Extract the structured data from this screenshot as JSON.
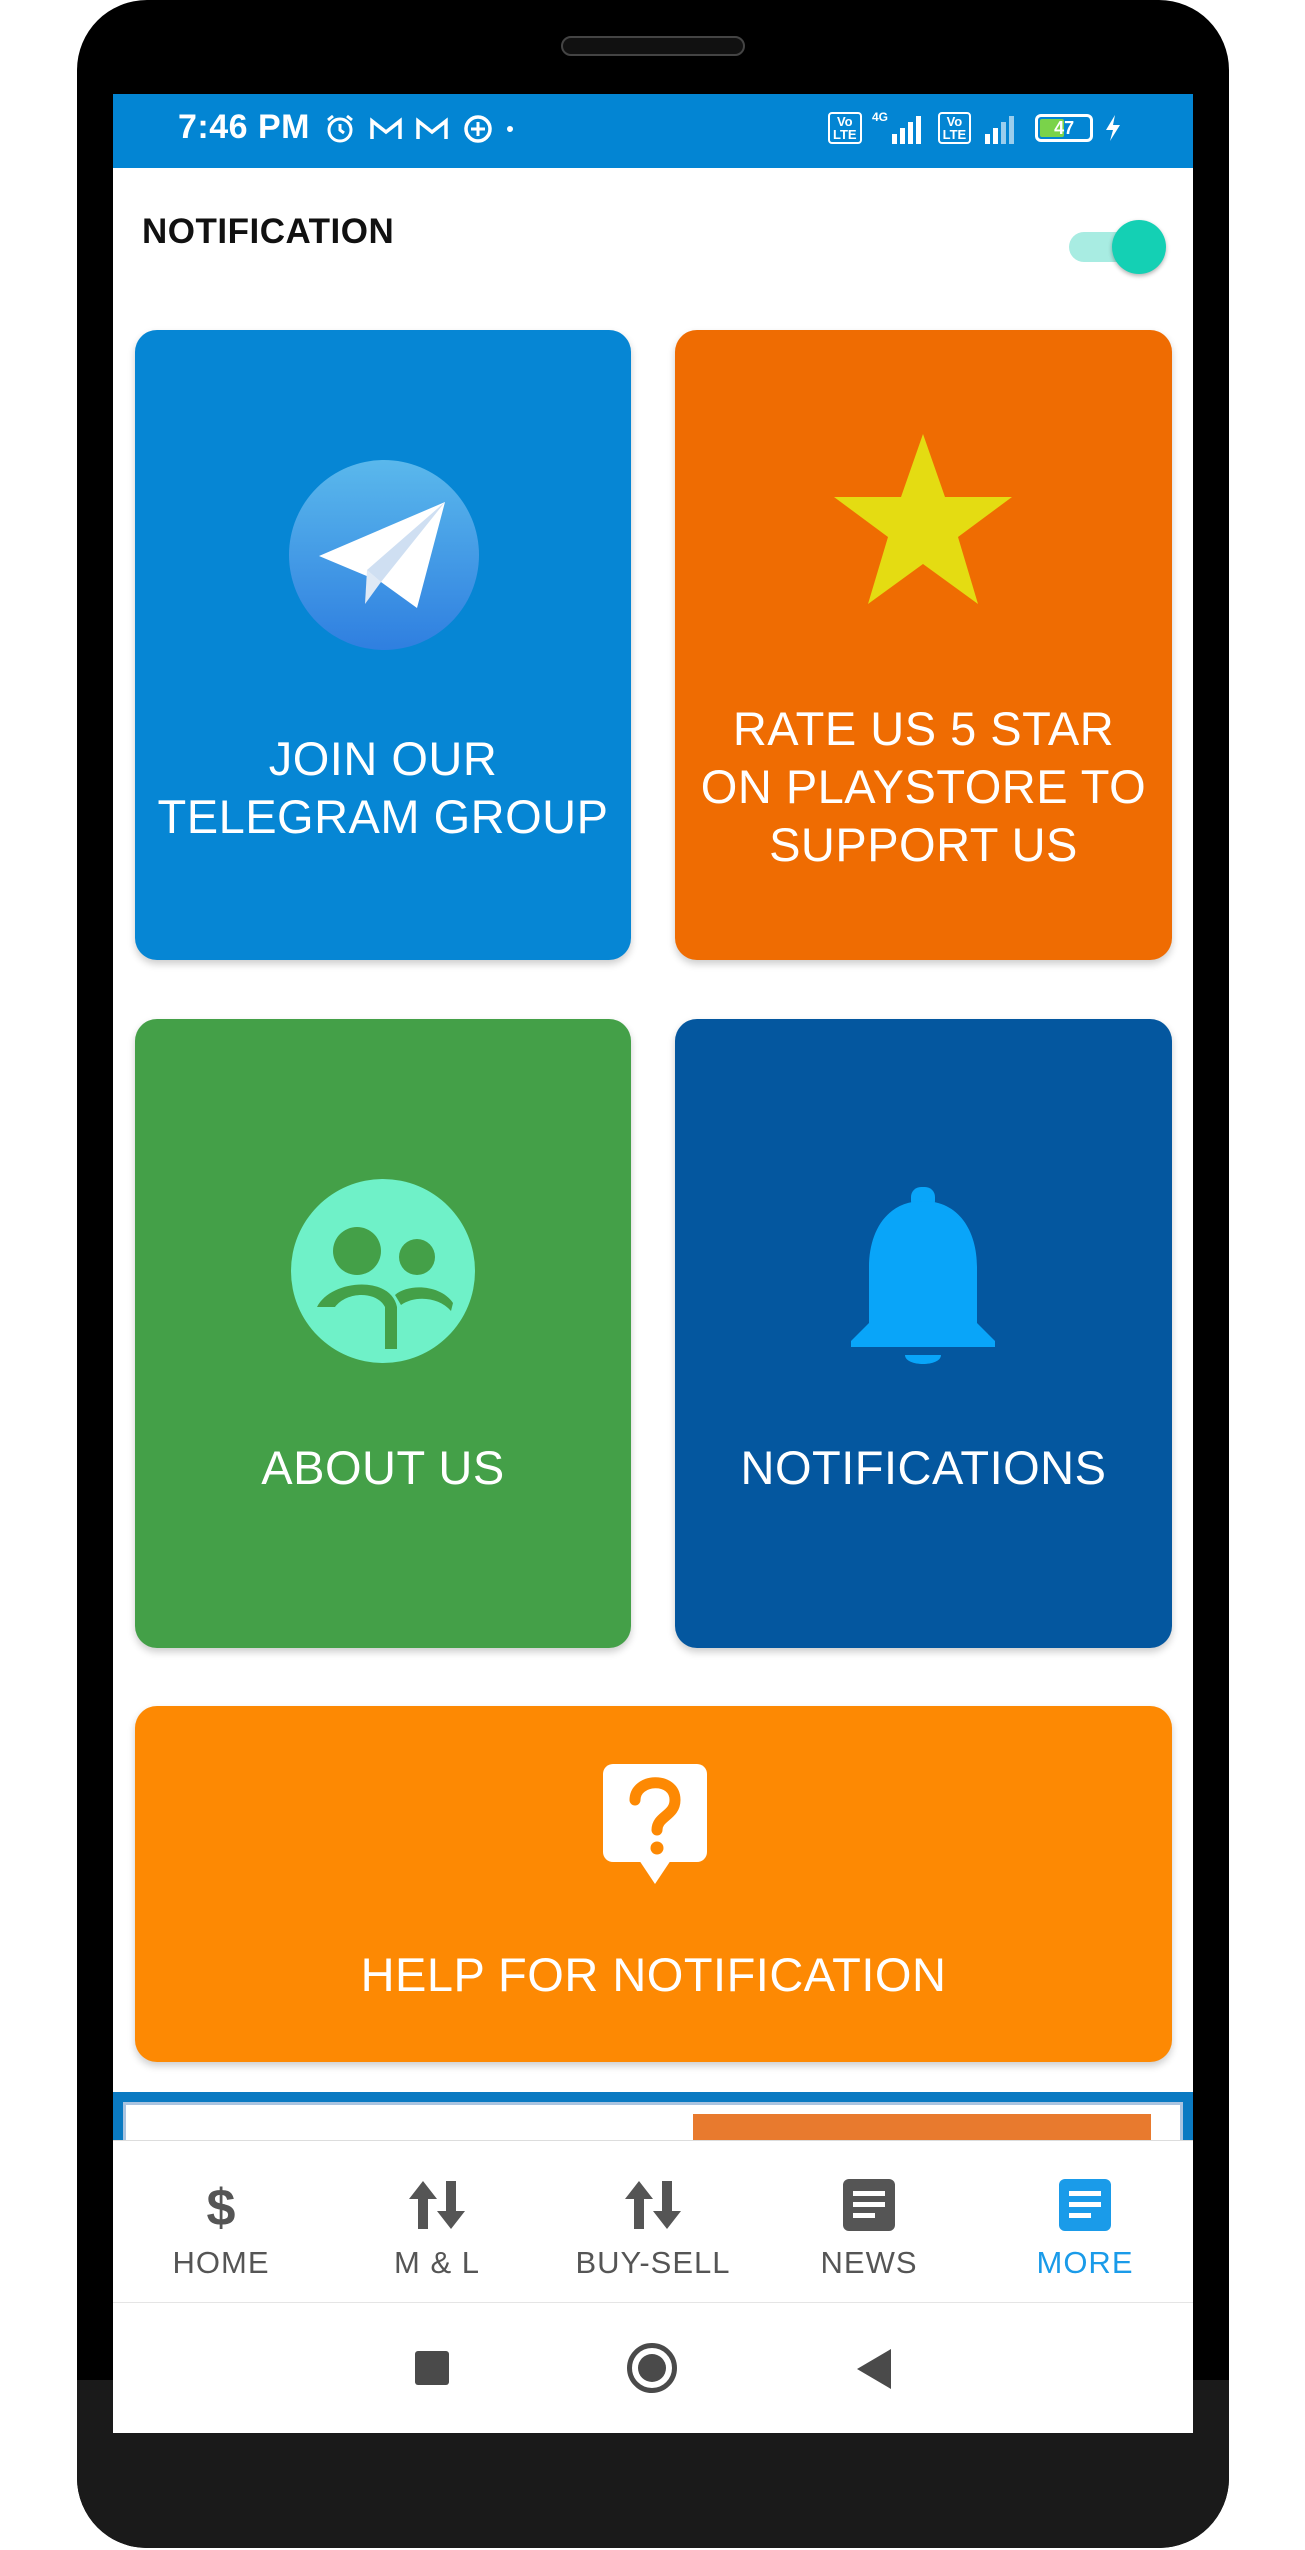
{
  "status_bar": {
    "time": "7:46 PM",
    "left_icons": [
      "alarm-icon",
      "gmail-icon",
      "gmail-icon",
      "data-saver-icon"
    ],
    "network_1": "4G",
    "lte_label": "Vo LTE",
    "battery": "47",
    "battery_level": 0.47,
    "charging": true
  },
  "notification_setting": {
    "label": "NOTIFICATION",
    "enabled": true
  },
  "cards": {
    "telegram": {
      "line1": "JOIN OUR",
      "line2": "TELEGRAM GROUP",
      "icon": "telegram-icon",
      "color": "#0686d4"
    },
    "rate": {
      "line1": "RATE US 5 STAR",
      "line2": "ON PLAYSTORE TO",
      "line3": "SUPPORT US",
      "icon": "star-icon",
      "color": "#ef6c02"
    },
    "about": {
      "label": "ABOUT US",
      "icon": "group-icon",
      "color": "#44a048"
    },
    "notifications": {
      "label": "NOTIFICATIONS",
      "icon": "bell-icon",
      "color": "#04579f"
    },
    "help": {
      "label": "HELP FOR NOTIFICATION",
      "icon": "help-icon",
      "color": "#fd8903"
    }
  },
  "bottom_nav": {
    "items": [
      {
        "label": "HOME",
        "icon": "dollar-icon"
      },
      {
        "label": "M & L",
        "icon": "updown-arrows-icon"
      },
      {
        "label": "BUY-SELL",
        "icon": "updown-arrows-icon"
      },
      {
        "label": "NEWS",
        "icon": "article-icon"
      },
      {
        "label": "MORE",
        "icon": "article-icon",
        "active": true
      }
    ],
    "active_color": "#1a9be9"
  }
}
